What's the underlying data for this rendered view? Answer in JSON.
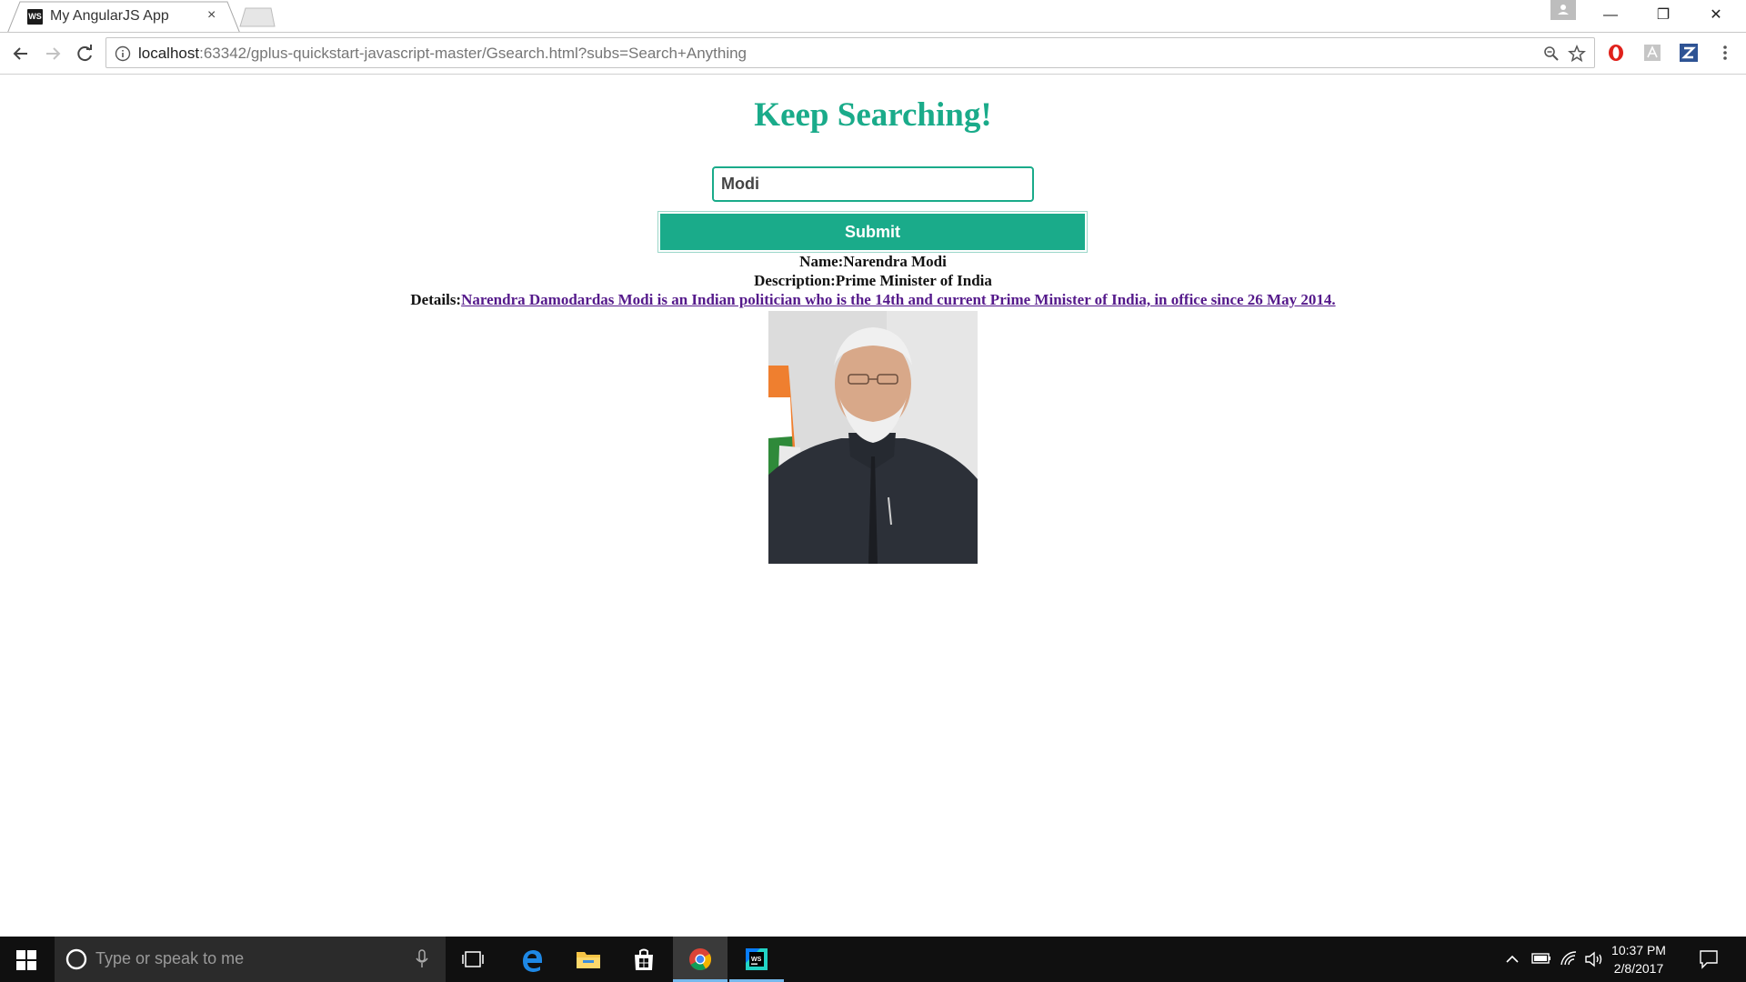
{
  "browser": {
    "tab_title": "My AngularJS App",
    "tab_favicon_text": "WS",
    "tab_close": "×",
    "url_host": "localhost",
    "url_path": ":63342/gplus-quickstart-javascript-master/Gsearch.html?subs=Search+Anything",
    "window_controls": {
      "minimize": "—",
      "restore": "❐",
      "close": "✕"
    }
  },
  "page": {
    "title": "Keep Searching!",
    "search_value": "Modi",
    "submit_label": "Submit",
    "name_label": "Name:",
    "name_value": "Narendra Modi",
    "description_label": "Description:",
    "description_value": "Prime Minister of India",
    "details_label": "Details:",
    "details_value": "Narendra Damodardas Modi is an Indian politician who is the 14th and current Prime Minister of India, in office since 26 May 2014. "
  },
  "taskbar": {
    "search_placeholder": "Type or speak to me",
    "clock_time": "10:37 PM",
    "clock_date": "2/8/2017",
    "apps": [
      "task-view",
      "edge",
      "file-explorer",
      "store",
      "chrome",
      "webstorm"
    ]
  },
  "colors": {
    "accent": "#1aab8a",
    "link_visited": "#551a8b",
    "taskbar": "#101010"
  }
}
